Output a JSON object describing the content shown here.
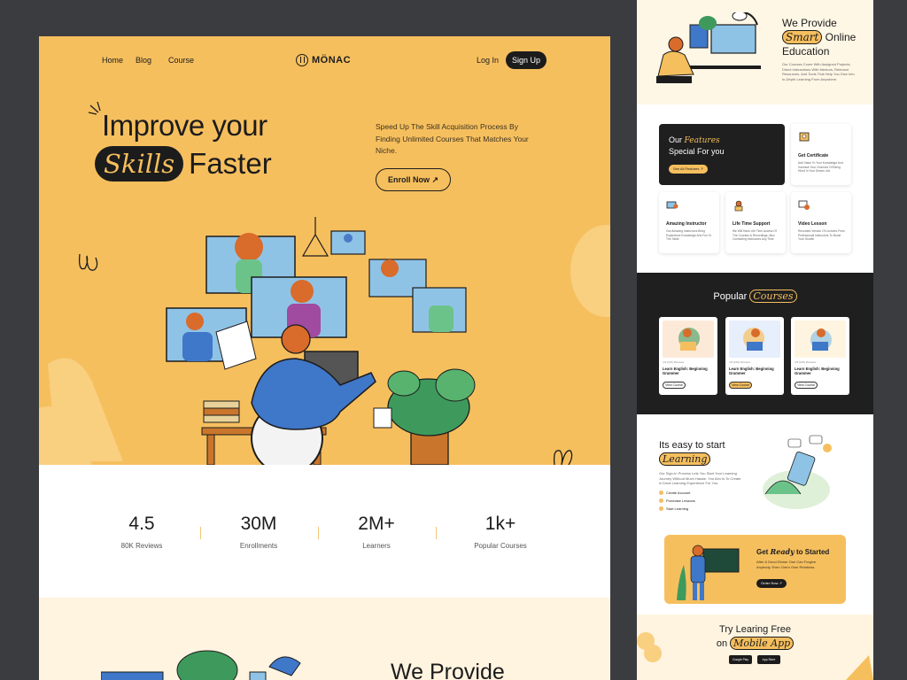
{
  "nav": {
    "home": "Home",
    "blog": "Blog",
    "course": "Course",
    "login": "Log In",
    "signup": "Sign Up"
  },
  "brand": {
    "name": "MÖNAC"
  },
  "hero": {
    "title_line1": "Improve your",
    "title_highlight": "Skills",
    "title_line2_rest": "Faster",
    "subtitle": "Speed Up The Skill Acquisition Process By Finding Unlimited Courses That Matches Your Niche.",
    "cta": "Enroll Now ↗"
  },
  "stats": [
    {
      "value": "4.5",
      "label": "80K Reviews"
    },
    {
      "value": "30M",
      "label": "Enrollments"
    },
    {
      "value": "2M+",
      "label": "Learners"
    },
    {
      "value": "1k+",
      "label": "Popular Courses"
    }
  ],
  "provide": {
    "title": "We Provide",
    "pre": "We Provide",
    "highlight": "Smart",
    "post": "Online",
    "line3": "Education",
    "desc": "Our Courses Come With Assigned Projects, Direct Interactions With Mentors, Relevant Resources, And Tools That Help You Dive Into In-Depth Learning From Anywhere."
  },
  "features": {
    "title_pre": "Our",
    "title_hl": "Features",
    "title_line2": "Special For you",
    "btn": "See All Features ↗",
    "items": [
      {
        "title": "Get Certificate",
        "desc": "Add Value To Your Knowledge And Increase Your Chances Of Being Hired In Your Dream Job."
      },
      {
        "title": "Amazing Instructor",
        "desc": "Our Amazing Instructors Bring Experience Knowledge And Fun To The Table."
      },
      {
        "title": "Life Time Support",
        "desc": "We Will Have Life Time Access Of The Courses & Recordings, Also Contacting Instructors Any Time"
      },
      {
        "title": "Video Lesson",
        "desc": "Recorded Version Of Lectures From Professional Instructors To Boost Your Growth"
      }
    ]
  },
  "popular": {
    "title": "Popular",
    "title_hl": "Courses",
    "courses": [
      {
        "meta": "4.8 (100) Reviews",
        "name": "Learn English: Beginning Grammer",
        "btn": "View Course"
      },
      {
        "meta": "4.8 (100) Reviews",
        "name": "Learn English: Beginning Grammer",
        "btn": "View Course"
      },
      {
        "meta": "4.8 (100) Reviews",
        "name": "Learn English: Beginning Grammer",
        "btn": "View Course"
      }
    ]
  },
  "easy": {
    "title": "Its easy to start",
    "title_hl": "Learning",
    "desc": "Our Sign-In Process Lets You Start Your Learning Journey Without Much Hassle. You Aim Is To Create A Great Learning Experience For You.",
    "steps": [
      "Create Account",
      "Purchase Lessons",
      "Start Learning"
    ]
  },
  "ready": {
    "pre": "Get",
    "hl": "Ready",
    "post": "to Started",
    "desc": "After A Good Dinner One Can Forgive Anybody, Even One's Own Relations.",
    "btn": "Order Now ↗"
  },
  "app": {
    "line1": "Try Learing Free",
    "on": "on",
    "hl": "Mobile App",
    "google": "Google Play",
    "apple": "App Store"
  },
  "colors": {
    "accent": "#f6bf5e",
    "dark": "#1c1c1c",
    "cream": "#fff4e0"
  }
}
